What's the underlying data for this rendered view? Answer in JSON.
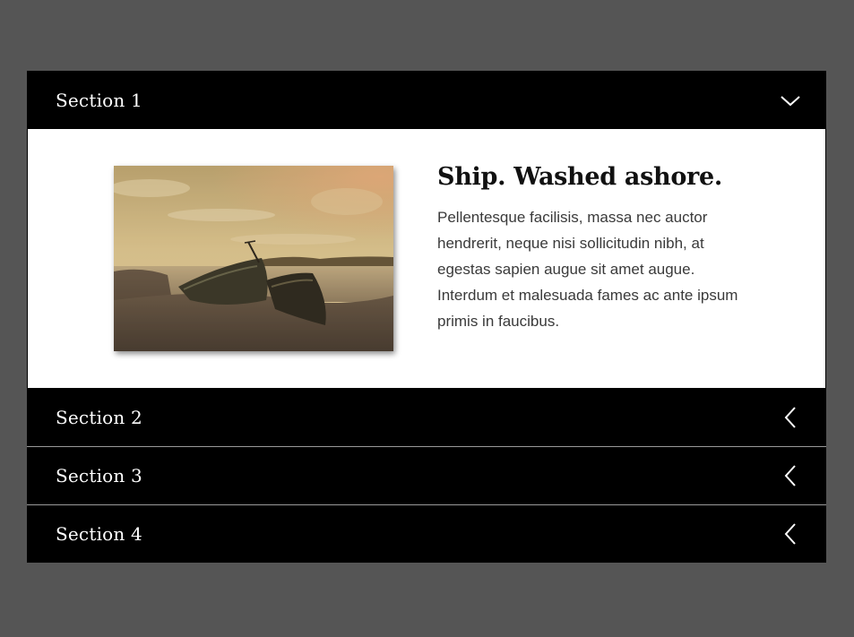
{
  "page": {
    "background_color": "#555555"
  },
  "accordion": {
    "sections": [
      {
        "title": "Section 1",
        "expanded": true,
        "icon": "chevron-down-icon",
        "content": {
          "image": "shipwreck-photo",
          "heading": "Ship. Washed ashore.",
          "body": "Pellentesque facilisis, massa nec auctor hendrerit, neque nisi sollicitudin nibh, at egestas sapien augue sit amet augue. Interdum et malesuada fames ac ante ipsum primis in faucibus."
        }
      },
      {
        "title": "Section 2",
        "expanded": false,
        "icon": "chevron-left-icon"
      },
      {
        "title": "Section 3",
        "expanded": false,
        "icon": "chevron-left-icon"
      },
      {
        "title": "Section 4",
        "expanded": false,
        "icon": "chevron-left-icon"
      }
    ],
    "colors": {
      "header_background": "#000000",
      "header_text": "#ffffff",
      "panel_background": "#ffffff",
      "body_text": "#3a3a3a"
    }
  }
}
